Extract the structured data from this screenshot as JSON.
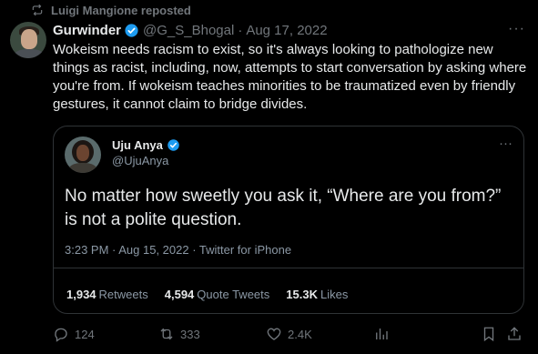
{
  "repost": {
    "text": "Luigi Mangione reposted",
    "icon": "repost-icon"
  },
  "tweet": {
    "author_name": "Gurwinder",
    "handle": "@G_S_Bhogal",
    "separator": "·",
    "date": "Aug 17, 2022",
    "more": "···",
    "text": "Wokeism needs racism to exist, so it's always looking to pathologize new things as racist, including, now, attempts to start conversation by asking where you're from. If wokeism teaches minorities to be traumatized even by friendly gestures, it cannot claim to bridge divides."
  },
  "quote": {
    "author_name": "Uju Anya",
    "handle": "@UjuAnya",
    "more": "···",
    "text": "No matter how sweetly you ask it, “Where are you from?” is not a polite question.",
    "meta": "3:23 PM · Aug 15, 2022 · Twitter for iPhone",
    "stats": [
      {
        "value": "1,934",
        "label": "Retweets"
      },
      {
        "value": "4,594",
        "label": "Quote Tweets"
      },
      {
        "value": "15.3K",
        "label": "Likes"
      }
    ]
  },
  "actions": {
    "reply_count": "124",
    "retweet_count": "333",
    "like_count": "2.4K"
  },
  "colors": {
    "background": "#000000",
    "text": "#e7e9ea",
    "muted": "#71767b",
    "verified": "#1d9bf0",
    "border": "#2f3336"
  }
}
